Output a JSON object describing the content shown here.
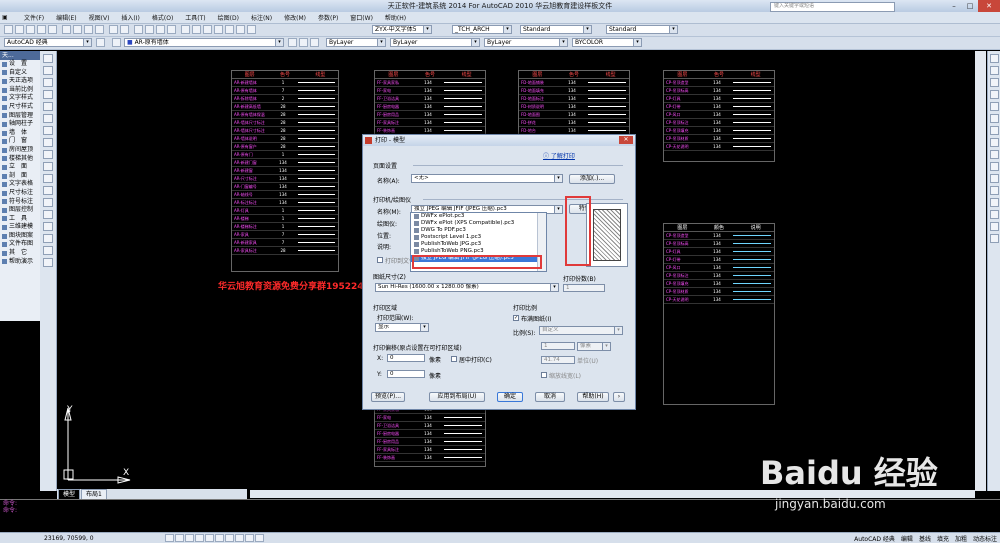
{
  "app": {
    "title": "天正软件-建筑系统 2014  For AutoCAD 2010      华云旭教育建设样板文件",
    "search_placeholder": "键入关键字或短语"
  },
  "menu": [
    "文件(F)",
    "编辑(E)",
    "视图(V)",
    "插入(I)",
    "格式(O)",
    "工具(T)",
    "绘图(D)",
    "标注(N)",
    "修改(M)",
    "参数(P)",
    "窗口(W)",
    "帮助(H)"
  ],
  "toolbar1": {
    "font_style": "ZYX-中文字体5",
    "text_style": "_TCH_ARCH",
    "dim_style": "Standard",
    "table_style": "Standard"
  },
  "toolbar2": {
    "workspace": "AutoCAD 经典",
    "layer": "AR-原有墙体",
    "color": "ByLayer",
    "linetype": "ByLayer",
    "lineweight": "ByLayer",
    "plotstyle": "BYCOLOR"
  },
  "palette": {
    "header": "天...",
    "items": [
      "设　置",
      "自定义",
      "天正选项",
      "当前比例",
      "文字样式",
      "尺寸样式",
      "图层管理",
      "轴网柱子",
      "墙　体",
      "门　窗",
      "房间屋顶",
      "楼梯其他",
      "立　面",
      "剖　面",
      "文字表格",
      "尺寸标注",
      "符号标注",
      "图层控制",
      "工　具",
      "三维建模",
      "图块图案",
      "文件布图",
      "其　它",
      "帮助演示"
    ]
  },
  "watermark": "华云旭教育资源免费分享群1952249",
  "drawing_tables": {
    "header": [
      "图层",
      "色号",
      "线型"
    ],
    "t1": [
      [
        "AR-新建墙体",
        "1"
      ],
      [
        "AR-原有墙体",
        "7"
      ],
      [
        "AR-拆除墙体",
        "2"
      ],
      [
        "AR-新建高低墙",
        "28"
      ],
      [
        "AR-原有墙体保温",
        "28"
      ],
      [
        "AR-墙体尺寸标注",
        "28"
      ],
      [
        "AR-墙体尺寸标注",
        "28"
      ],
      [
        "AR-墙体说明",
        "28"
      ],
      [
        "AR-原有窗户",
        "28"
      ],
      [
        "AR-原有门",
        "1"
      ],
      [
        "AR-新建门窗",
        "134"
      ],
      [
        "AR-新建窗",
        "134"
      ],
      [
        "AR-尺寸标注",
        "134"
      ],
      [
        "AR-门窗编号",
        "134"
      ],
      [
        "AR-轴线号",
        "134"
      ],
      [
        "AR-标注标注",
        "134"
      ],
      [
        "AR-灯具",
        "1"
      ],
      [
        "AR-楼梯",
        "1"
      ],
      [
        "AR-楼梯标注",
        "1"
      ],
      [
        "AR-家具",
        "7"
      ],
      [
        "AR-新建家具",
        "7"
      ],
      [
        "AR-家具标注",
        "28"
      ]
    ],
    "t2": [
      [
        "FF-家具家私",
        "134"
      ],
      [
        "FF-家电",
        "134"
      ],
      [
        "FF-卫浴洁具",
        "134"
      ],
      [
        "FF-厨房电器",
        "134"
      ],
      [
        "FF-厨房用品",
        "134"
      ],
      [
        "FF-家具标注",
        "134"
      ],
      [
        "FF-装饰画",
        "134"
      ],
      [
        "FF-植物",
        "134"
      ],
      [
        "FF-灯饰",
        "134"
      ],
      [
        "FF-窗帘",
        "134"
      ]
    ],
    "t3": [
      [
        "FD-地面铺装",
        "134"
      ],
      [
        "FD-地面填充",
        "134"
      ],
      [
        "FD-地面标注",
        "134"
      ],
      [
        "FD-材质说明",
        "134"
      ],
      [
        "FD-地面图",
        "134"
      ],
      [
        "FD-拼花",
        "134"
      ],
      [
        "FD-地台",
        "134"
      ],
      [
        "FD-铺装标注",
        "134"
      ],
      [
        "FD-地毯",
        "134"
      ],
      [
        "FD-标高",
        "134"
      ]
    ],
    "t4": [
      [
        "CP-吊顶造型",
        "134"
      ],
      [
        "CP-吊顶标高",
        "134"
      ],
      [
        "CP-灯具",
        "134"
      ],
      [
        "CP-灯带",
        "134"
      ],
      [
        "CP-风口",
        "134"
      ],
      [
        "CP-吊顶标注",
        "134"
      ],
      [
        "CP-吊顶填充",
        "134"
      ],
      [
        "CP-吊顶材质",
        "134"
      ],
      [
        "CP-天花说明",
        "134"
      ]
    ],
    "t5_header": [
      "图层",
      "颜色",
      "说明"
    ]
  },
  "ucs": {
    "x_label": "X",
    "y_label": "Y"
  },
  "tabs": [
    "模型",
    "布局1"
  ],
  "command_lines": [
    "命令:",
    "命令:"
  ],
  "status": {
    "coords": "23169, 70599, 0",
    "workspace": "AutoCAD 经典",
    "right_items": [
      "编辑",
      "基线",
      "填充",
      "加粗",
      "动态标注"
    ]
  },
  "dialog": {
    "title": "打印 - 模型",
    "learn_link": "了解打印",
    "page_setup": {
      "group": "页面设置",
      "name_label": "名称(A):",
      "name_value": "<无>",
      "add_button": "添加(.)..."
    },
    "printer": {
      "group": "打印机/绘图仪",
      "name_label": "名称(M):",
      "name_value": "PublishToWeb JPG.pc3",
      "properties_button": "特性(R)...",
      "plotter_label": "绘图仪:",
      "location_label": "位置:",
      "desc_label": "说明:",
      "print_to_file": "打印到文件(F)"
    },
    "dropdown_options": [
      "独立 JPEG 编辑 JFIF (JPEG 压缩).pc3",
      "DWFx ePlot.pc3",
      "DWFx ePlot (XPS Compatible).pc3",
      "DWG To PDF.pc3",
      "Postscript Level 1.pc3",
      "PublishToWeb JPG.pc3",
      "PublishToWeb PNG.pc3",
      "独立 JPEG 编辑 JFIF (JPEG 压缩).pc3"
    ],
    "dropdown_selected_index": 7,
    "paper": {
      "label": "图纸尺寸(Z)",
      "value": "Sun Hi-Res (1600.00 x 1280.00 像素)",
      "copies_label": "打印份数(B)",
      "copies_value": "1"
    },
    "plot_area": {
      "group": "打印区域",
      "range_label": "打印范围(W):",
      "range_value": "显示"
    },
    "plot_scale": {
      "group": "打印比例",
      "fit_label": "布满图纸(I)",
      "fit_checked": true,
      "scale_label": "比例(S):",
      "scale_value": "自定义",
      "v1": "1",
      "unit": "像素",
      "v2": "41.74",
      "unit2": "单位(U)",
      "lineweight": "缩放线宽(L)"
    },
    "offset": {
      "group": "打印偏移(原点设置在可打印区域)",
      "x_label": "X:",
      "x_value": "0",
      "x_unit": "像素",
      "center_label": "居中打印(C)",
      "y_label": "Y:",
      "y_value": "0",
      "y_unit": "像素"
    },
    "buttons": {
      "preview": "预览(P)...",
      "apply": "应用到布局(U)",
      "ok": "确定",
      "cancel": "取消",
      "help": "帮助(H)"
    }
  },
  "watermark_brand": "Baidu 经验",
  "watermark_url": "jingyan.baidu.com",
  "colors": {
    "canvas": "#000000",
    "highlight": "#e03a3a",
    "layer_text": "#ff4fff",
    "selection": "#3a78d8"
  }
}
